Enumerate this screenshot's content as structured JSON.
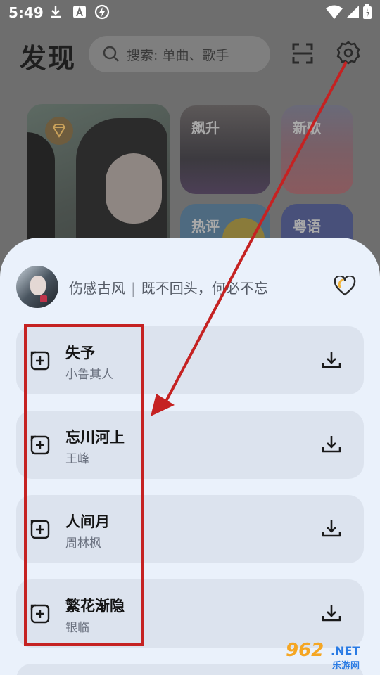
{
  "status_bar": {
    "time": "5:49"
  },
  "header": {
    "title": "发现",
    "search_placeholder": "搜索: 单曲、歌手"
  },
  "cards": {
    "soar": "飙升",
    "new": "新歌",
    "hot": "热评",
    "canto": "粤语"
  },
  "sheet": {
    "category": "伤感古风",
    "playlist_name": "既不回头，何必不忘",
    "songs": [
      {
        "title": "失予",
        "artist": "小鲁其人"
      },
      {
        "title": "忘川河上",
        "artist": "王峰"
      },
      {
        "title": "人间月",
        "artist": "周林枫"
      },
      {
        "title": "繁花渐隐",
        "artist": "银临"
      }
    ]
  },
  "watermark": {
    "number": "962",
    "domain": ".NET",
    "chinese": "乐游网"
  },
  "colors": {
    "annotation": "#c52222",
    "sheet_bg": "#eaf1fb",
    "row_bg": "#dce3ee"
  },
  "icons": [
    "download-icon",
    "a-icon",
    "no-ads-icon",
    "wifi-icon",
    "signal-icon",
    "battery-icon",
    "search-icon",
    "scan-icon",
    "gear-icon",
    "diamond-icon",
    "heart-icon",
    "add-to-playlist-icon",
    "download-icon"
  ]
}
